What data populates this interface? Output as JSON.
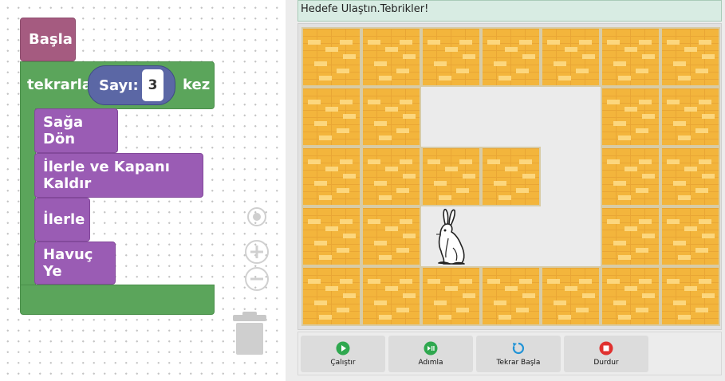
{
  "workspace": {
    "blocks": {
      "start": "Başla",
      "repeat_prefix": "tekrarla",
      "number_label": "Sayı:",
      "number_value": "3",
      "repeat_suffix": "kez",
      "turn_right": "Sağa Dön",
      "advance_remove_trap": "İlerle ve Kapanı Kaldır",
      "advance": "İlerle",
      "eat_carrot": "Havuç Ye"
    },
    "colors": {
      "event": "#a55b80",
      "loop": "#5ba55b",
      "action": "#9a5cb4",
      "number": "#5b67a5"
    }
  },
  "game": {
    "status": "Hedefe Ulaştın.Tebrikler!",
    "board": {
      "rows": 5,
      "cols": 7,
      "floor_cells": [
        "1-2",
        "1-3",
        "1-4",
        "2-4",
        "3-2",
        "3-3",
        "3-4"
      ],
      "rabbit_cell": "3-2",
      "rabbit_icon": "rabbit-icon"
    },
    "controls": {
      "run": "Çalıştır",
      "step": "Adımla",
      "restart": "Tekrar Başla",
      "stop": "Durdur"
    },
    "control_colors": {
      "run": "#2fa84f",
      "step": "#2fa84f",
      "restart": "#2193d6",
      "stop": "#e0312f"
    }
  }
}
